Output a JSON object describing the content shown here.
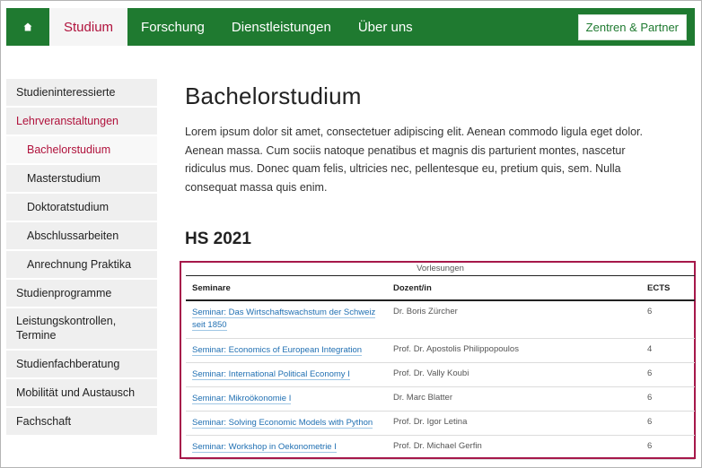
{
  "nav": {
    "items": [
      {
        "label": "Studium"
      },
      {
        "label": "Forschung"
      },
      {
        "label": "Dienstleistungen"
      },
      {
        "label": "Über uns"
      }
    ],
    "partner_button": "Zentren & Partner"
  },
  "sidebar": {
    "items": [
      {
        "label": "Studieninteressierte"
      },
      {
        "label": "Lehrveranstaltungen"
      },
      {
        "label": "Bachelorstudium"
      },
      {
        "label": "Masterstudium"
      },
      {
        "label": "Doktoratstudium"
      },
      {
        "label": "Abschlussarbeiten"
      },
      {
        "label": "Anrechnung Praktika"
      },
      {
        "label": "Studienprogramme"
      },
      {
        "label": "Leistungskontrollen, Termine"
      },
      {
        "label": "Studienfachberatung"
      },
      {
        "label": "Mobilität und Austausch"
      },
      {
        "label": "Fachschaft"
      }
    ]
  },
  "main": {
    "title": "Bachelorstudium",
    "lead": "Lorem ipsum dolor sit amet, consectetuer adipiscing elit. Aenean commodo ligula eget dolor. Aenean massa. Cum sociis natoque penatibus et magnis dis parturient montes, nascetur ridiculus mus. Donec quam felis, ultricies nec, pellentesque eu, pretium quis, sem. Nulla consequat massa quis enim.",
    "section_title": "HS 2021"
  },
  "table": {
    "caption": "Vorlesungen",
    "headers": [
      "Seminare",
      "Dozent/in",
      "ECTS"
    ],
    "rows": [
      {
        "course": "Seminar: Das Wirtschaftswachstum der Schweiz seit 1850",
        "lecturer": "Dr. Boris Zürcher",
        "ects": "6"
      },
      {
        "course": "Seminar: Economics of European Integration",
        "lecturer": "Prof. Dr. Apostolis Philippopoulos",
        "ects": "4"
      },
      {
        "course": "Seminar: International Political Economy I",
        "lecturer": "Prof. Dr. Vally Koubi",
        "ects": "6"
      },
      {
        "course": "Seminar: Mikroökonomie I",
        "lecturer": "Dr. Marc Blatter",
        "ects": "6"
      },
      {
        "course": "Seminar: Solving Economic Models with Python",
        "lecturer": "Prof. Dr. Igor Letina",
        "ects": "6"
      },
      {
        "course": "Seminar: Workshop in Oekonometrie I",
        "lecturer": "Prof. Dr. Michael Gerfin",
        "ects": "6"
      }
    ]
  },
  "colors": {
    "brand_green": "#1f7a30",
    "accent_red": "#b0123c",
    "link_blue": "#1f6fb2",
    "table_border": "#a6184a"
  },
  "icons": {
    "home": "home-icon"
  }
}
